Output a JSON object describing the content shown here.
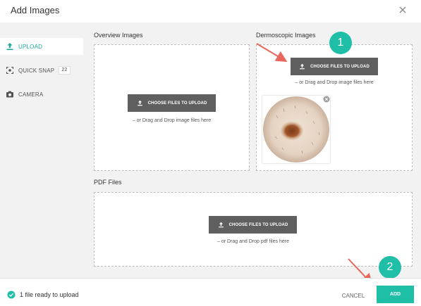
{
  "dialog": {
    "title": "Add Images",
    "close_icon": "close-icon"
  },
  "sidebar": {
    "items": [
      {
        "label": "UPLOAD",
        "icon": "upload-icon",
        "active": true
      },
      {
        "label": "QUICK SNAP",
        "icon": "quick-snap-icon",
        "badge": "22"
      },
      {
        "label": "CAMERA",
        "icon": "camera-icon"
      }
    ]
  },
  "sections": {
    "overview": {
      "label": "Overview Images",
      "button": "CHOOSE FILES TO UPLOAD",
      "hint": "– or Drag and Drop image files here"
    },
    "dermoscopic": {
      "label": "Dermoscopic Images",
      "button": "CHOOSE FILES TO UPLOAD",
      "hint": "– or Drag and Drop image files here"
    },
    "pdf": {
      "label": "PDF Files",
      "button": "CHOOSE FILES TO UPLOAD",
      "hint": "– or Drag and Drop pdf files here"
    }
  },
  "callouts": [
    "1",
    "2"
  ],
  "footer": {
    "status": "1 file ready to upload",
    "cancel_label": "CANCEL",
    "add_label": "ADD"
  },
  "colors": {
    "accent": "#1fbfa7",
    "button_dark": "#5f5f5f",
    "annotation_arrow": "#e8665c",
    "sidebar_bg": "#f2f2f2"
  }
}
